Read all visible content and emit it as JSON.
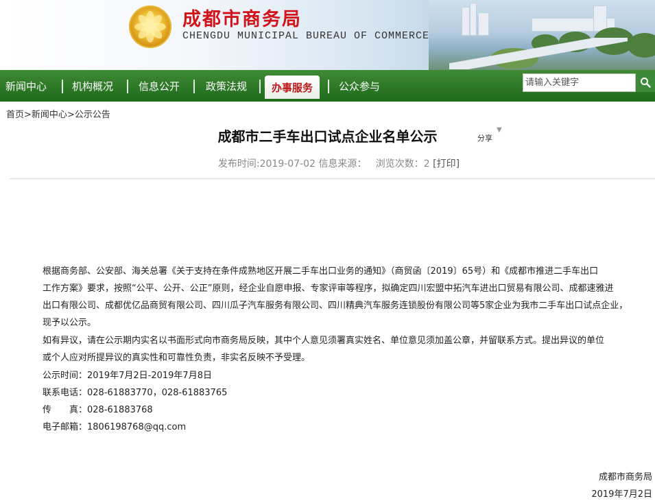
{
  "header": {
    "org_cn": "成都市商务局",
    "org_en": "CHENGDU MUNICIPAL BUREAU OF COMMERCE"
  },
  "nav": {
    "items": [
      {
        "label": "新闻中心"
      },
      {
        "label": "机构概况"
      },
      {
        "label": "信息公开"
      },
      {
        "label": "政策法规"
      },
      {
        "label": "办事服务",
        "active": true
      },
      {
        "label": "公众参与"
      }
    ],
    "search_placeholder": "请输入关键字",
    "search_icon": "search-icon"
  },
  "breadcrumb": {
    "home": "首页",
    "sep": ">",
    "level1": "新闻中心",
    "level2": "公示公告"
  },
  "article": {
    "title": "成都市二手车出口试点企业名单公示",
    "share_label": "分享",
    "meta_published_label": "发布时间:",
    "meta_published_date": "2019-07-02",
    "meta_source_label": "信息来源：",
    "meta_views_label": "浏览次数：",
    "meta_views_count": "2",
    "print_label": "[打印]",
    "body_lines": [
      "根据商务部、公安部、海关总署《关于支持在条件成熟地区开展二手车出口业务的通知》（商贸函〔2019〕65号）和《成都市推进二手车出口",
      "工作方案》要求，按照“公平、公开、公正”原则，经企业自愿申报、专家评审等程序，拟确定四川宏盟中拓汽车进出口贸易有限公司、成都速雅进",
      "出口有限公司、成都优亿品商贸有限公司、四川瓜子汽车服务有限公司、四川精典汽车服务连锁股份有限公司等5家企业为我市二手车出口试点企业，",
      "现予以公示。",
      "如有异议，请在公示期内实名以书面形式向市商务局反映，其中个人意见须署真实姓名、单位意见须加盖公章，并留联系方式。提出异议的单位",
      "或个人应对所提异议的真实性和可靠性负责，非实名反映不予受理。"
    ],
    "period_label": "公示时间：",
    "period_value": "2019年7月2日-2019年7月8日",
    "phone_label": "联系电话：",
    "phone_value": "028-61883770，028-61883765",
    "fax_label": "传　　真：",
    "fax_value": "028-61883768",
    "email_label": "电子邮箱：",
    "email_value": "1806198768@qq.com",
    "signature_org": "成都市商务局",
    "signature_date": "2019年7月2日"
  },
  "colors": {
    "nav_green": "#2a7a25",
    "brand_red": "#d2131a",
    "active_tab_text": "#c0181a"
  }
}
